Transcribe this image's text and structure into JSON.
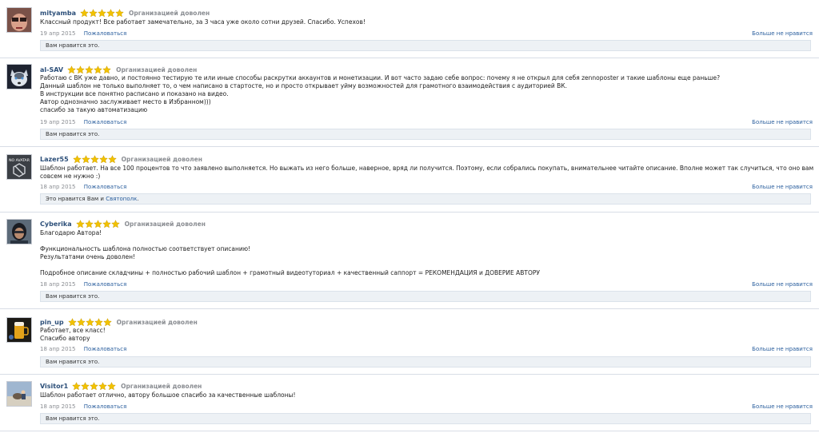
{
  "reviews": [
    {
      "username": "mityamba",
      "rating": 5,
      "verdict": "Организацией доволен",
      "text": "Классный продукт! Все работает замечательно, за 3 часа уже около сотни друзей. Спасибо. Успехов!",
      "date": "19 апр 2015",
      "report_label": "Пожаловаться",
      "unlike_label": "Больше не нравится",
      "likes_text": "Вам нравится это.",
      "likes_prefix": "",
      "likes_link": "",
      "likes_suffix": ""
    },
    {
      "username": "al-SAV",
      "rating": 5,
      "verdict": "Организацией доволен",
      "text": "Работаю с ВК уже давно, и постоянно тестирую те или иные способы раскрутки аккаунтов и монетизации. И вот часто задаю себе вопрос: почему я не открыл для себя zennoposter и такие шаблоны еще раньше?\nДанный шаблон не только выполняет то, о чем написано в стартосте, но и просто открывает уйму возможностей для грамотного взаимодействия с аудиторией ВК.\nВ инструкции все понятно расписано и показано на видео.\nАвтор однозначно заслуживает место в Избранном)))\nспасибо за такую автоматизацию",
      "date": "19 апр 2015",
      "report_label": "Пожаловаться",
      "unlike_label": "Больше не нравится",
      "likes_text": "Вам нравится это.",
      "likes_prefix": "",
      "likes_link": "",
      "likes_suffix": ""
    },
    {
      "username": "Lazer55",
      "rating": 5,
      "verdict": "Организацией доволен",
      "text": "Шаблон работает. На все 100 процентов то что заявлено выполняется. Но выжать из него больше, наверное, вряд ли получится. Поэтому, если собрались покупать, внимательнее читайте описание. Вполне может так случиться, что оно вам\nсовсем не нужно :)",
      "date": "18 апр 2015",
      "report_label": "Пожаловаться",
      "unlike_label": "Больше не нравится",
      "likes_text": "",
      "likes_prefix": "Это нравится Вам и ",
      "likes_link": "Святополк",
      "likes_suffix": "."
    },
    {
      "username": "Cyberika",
      "rating": 5,
      "verdict": "Организацией доволен",
      "text": "Благодарю Автора!\n\nФункциональность шаблона полностью соответствует описанию!\nРезультатами очень доволен!\n\nПодробное описание складчины + полностью рабочий шаблон + грамотный видеотуториал + качественный саппорт = РЕКОМЕНДАЦИЯ и ДОВЕРИЕ АВТОРУ",
      "date": "18 апр 2015",
      "report_label": "Пожаловаться",
      "unlike_label": "Больше не нравится",
      "likes_text": "Вам нравится это.",
      "likes_prefix": "",
      "likes_link": "",
      "likes_suffix": ""
    },
    {
      "username": "pin_up",
      "rating": 5,
      "verdict": "Организацией доволен",
      "text": "Работает, все класс!\nСпасибо автору",
      "date": "18 апр 2015",
      "report_label": "Пожаловаться",
      "unlike_label": "Больше не нравится",
      "likes_text": "Вам нравится это.",
      "likes_prefix": "",
      "likes_link": "",
      "likes_suffix": ""
    },
    {
      "username": "Visitor1",
      "rating": 5,
      "verdict": "Организацией доволен",
      "text": "Шаблон работает отлично, автору большое спасибо за качественные шаблоны!",
      "date": "18 апр 2015",
      "report_label": "Пожаловаться",
      "unlike_label": "Больше не нравится",
      "likes_text": "Вам нравится это.",
      "likes_prefix": "",
      "likes_link": "",
      "likes_suffix": ""
    }
  ],
  "avatars": {
    "no_avatar_text": "NO AVATAR"
  },
  "colors": {
    "username": "#2b4e78",
    "link": "#2b5f9e",
    "star": "#f2c200",
    "muted": "#8a8d92"
  }
}
